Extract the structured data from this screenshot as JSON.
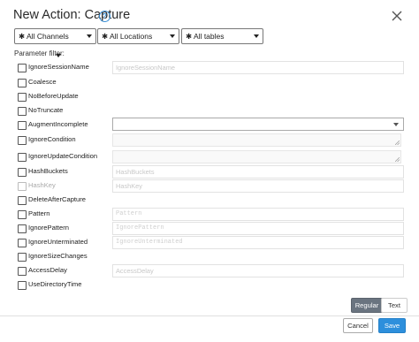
{
  "dialog": {
    "title": "New Action: Capture",
    "help_glyph": "?"
  },
  "filters": [
    {
      "label": "✱ All Channels"
    },
    {
      "label": "✱ All Locations"
    },
    {
      "label": "✱ All tables"
    }
  ],
  "parameter_filter": {
    "label": "Parameter filter:"
  },
  "params": [
    {
      "name": "IgnoreSessionName",
      "checked": false,
      "enabled": true,
      "input": "text",
      "placeholder": "IgnoreSessionName"
    },
    {
      "name": "Coalesce",
      "checked": false,
      "enabled": true,
      "input": "none"
    },
    {
      "name": "NoBeforeUpdate",
      "checked": false,
      "enabled": true,
      "input": "none"
    },
    {
      "name": "NoTruncate",
      "checked": false,
      "enabled": true,
      "input": "none"
    },
    {
      "name": "AugmentIncomplete",
      "checked": false,
      "enabled": true,
      "input": "dropdown",
      "placeholder": ""
    },
    {
      "name": "IgnoreCondition",
      "checked": false,
      "enabled": true,
      "input": "textarea"
    },
    {
      "name": "IgnoreUpdateCondition",
      "checked": false,
      "enabled": true,
      "input": "textarea"
    },
    {
      "name": "HashBuckets",
      "checked": false,
      "enabled": true,
      "input": "text",
      "placeholder": "HashBuckets"
    },
    {
      "name": "HashKey",
      "checked": false,
      "enabled": false,
      "input": "text",
      "placeholder": "HashKey"
    },
    {
      "name": "DeleteAfterCapture",
      "checked": false,
      "enabled": true,
      "input": "none"
    },
    {
      "name": "Pattern",
      "checked": false,
      "enabled": true,
      "input": "mono",
      "placeholder": "Pattern"
    },
    {
      "name": "IgnorePattern",
      "checked": false,
      "enabled": true,
      "input": "mono",
      "placeholder": "IgnorePattern"
    },
    {
      "name": "IgnoreUnterminated",
      "checked": false,
      "enabled": true,
      "input": "mono",
      "placeholder": "IgnoreUnterminated"
    },
    {
      "name": "IgnoreSizeChanges",
      "checked": false,
      "enabled": true,
      "input": "none"
    },
    {
      "name": "AccessDelay",
      "checked": false,
      "enabled": true,
      "input": "text",
      "placeholder": "AccessDelay"
    },
    {
      "name": "UseDirectoryTime",
      "checked": false,
      "enabled": true,
      "input": "none"
    }
  ],
  "mode_toggle": {
    "regular_label": "Regular",
    "text_label": "Text",
    "active": "Regular"
  },
  "footer": {
    "cancel_label": "Cancel",
    "save_label": "Save"
  },
  "colors": {
    "primary": "#2d8fdc",
    "toggle_active": "#6a7480",
    "help": "#3a8fd6"
  }
}
